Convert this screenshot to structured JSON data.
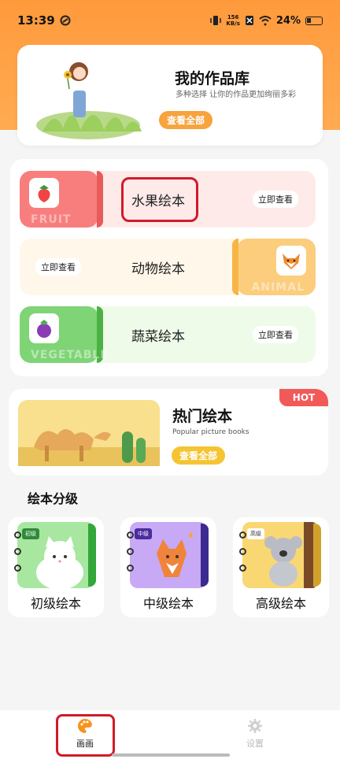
{
  "status_bar": {
    "time": "13:39",
    "net_speed_value": "156",
    "net_speed_unit": "KB/s",
    "battery": "24%"
  },
  "hero": {
    "title": "我的作品库",
    "subtitle": "多种选择 让你的作品更加绚丽多彩",
    "button": "查看全部"
  },
  "categories": [
    {
      "name": "水果绘本",
      "watermark": "FRUIT",
      "button": "立即查看"
    },
    {
      "name": "动物绘本",
      "watermark": "ANIMAL",
      "button": "立即查看"
    },
    {
      "name": "蔬菜绘本",
      "watermark": "VEGETABLE",
      "button": "立即查看"
    }
  ],
  "hot": {
    "tag": "HOT",
    "title": "热门绘本",
    "subtitle": "Popular picture books",
    "button": "查看全部"
  },
  "levels_section": {
    "title": "绘本分级",
    "items": [
      {
        "badge": "初级",
        "label": "初级绘本"
      },
      {
        "badge": "中级",
        "label": "中级绘本"
      },
      {
        "badge": "高级",
        "label": "高级绘本"
      }
    ]
  },
  "bottom_nav": {
    "items": [
      {
        "label": "画画",
        "icon": "palette-icon"
      },
      {
        "label": "设置",
        "icon": "gear-icon"
      }
    ]
  },
  "colors": {
    "accent_orange": "#ff9a3c",
    "highlight_red": "#d11a2a",
    "hot_red": "#f25a5a"
  }
}
